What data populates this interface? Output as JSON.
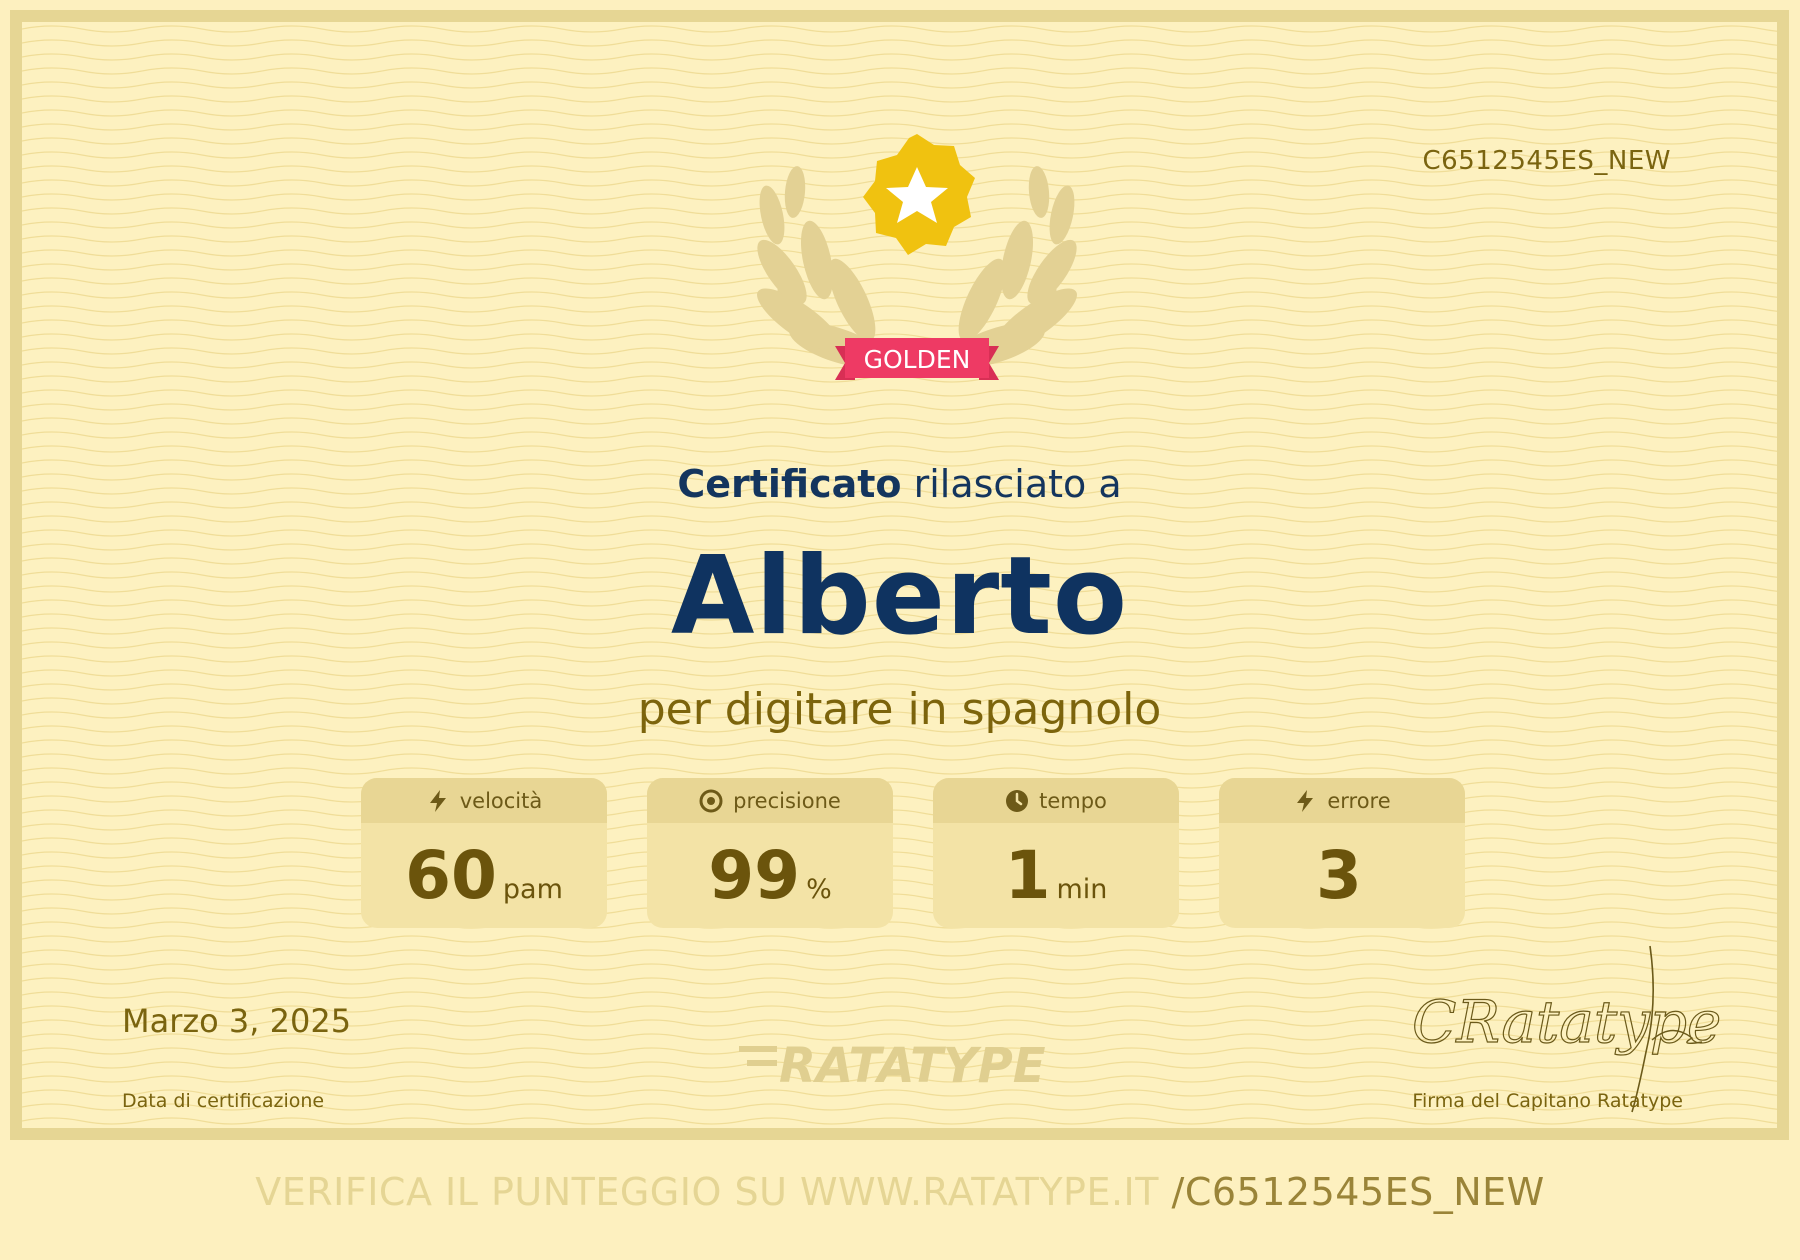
{
  "certificate": {
    "code": "C6512545ES_NEW",
    "badge_label": "GOLDEN",
    "heading_bold": "Certificato",
    "heading_rest": " rilasciato a",
    "name": "Alberto",
    "subtitle": "per digitare in spagnolo",
    "stats": [
      {
        "label": "velocità",
        "icon": "lightning-icon",
        "value": "60",
        "unit": "pam"
      },
      {
        "label": "precisione",
        "icon": "target-icon",
        "value": "99",
        "unit": "%"
      },
      {
        "label": "tempo",
        "icon": "clock-icon",
        "value": "1",
        "unit": "min"
      },
      {
        "label": "errore",
        "icon": "lightning-icon",
        "value": "3",
        "unit": ""
      }
    ],
    "date": "Marzo 3, 2025",
    "date_label": "Data di certificazione",
    "logo_text": "RATATYPE",
    "signature_text": "CRatatype",
    "signature_label": "Firma del Capitano Ratatype"
  },
  "footer": {
    "verify_prefix": "VERIFICA IL PUNTEGGIO SU WWW.RATATYPE.IT ",
    "verify_id": "/C6512545ES_NEW"
  },
  "colors": {
    "background": "#fdf1c0",
    "border": "#e6d694",
    "badge": "#ee3a64",
    "star": "#f0c210",
    "name": "#0f3360",
    "accent_text": "#7c640c"
  }
}
